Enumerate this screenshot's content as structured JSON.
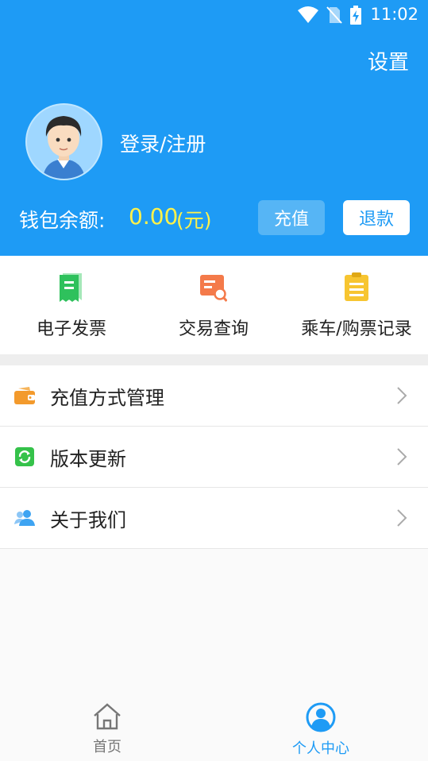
{
  "status_bar": {
    "time": "11:02",
    "icons": [
      "wifi-icon",
      "no-sim-icon",
      "battery-charging-icon"
    ]
  },
  "header": {
    "settings_label": "设置",
    "login_label": "登录/注册",
    "wallet": {
      "label": "钱包余额:",
      "amount": "0.00",
      "unit": "(元)",
      "recharge_label": "充值",
      "refund_label": "退款"
    }
  },
  "quick_actions": [
    {
      "label": "电子发票",
      "icon": "receipt-icon",
      "color": "#2ec15c"
    },
    {
      "label": "交易查询",
      "icon": "transaction-search-icon",
      "color": "#f47a4a"
    },
    {
      "label": "乘车/购票记录",
      "icon": "clipboard-list-icon",
      "color": "#f7c531"
    }
  ],
  "menu": [
    {
      "label": "充值方式管理",
      "icon": "wallet-icon",
      "color": "#f39a2c"
    },
    {
      "label": "版本更新",
      "icon": "refresh-icon",
      "color": "#35c24a"
    },
    {
      "label": "关于我们",
      "icon": "users-icon",
      "color": "#3ea4f2"
    }
  ],
  "tab_bar": [
    {
      "label": "首页",
      "icon": "home-icon",
      "active": false
    },
    {
      "label": "个人中心",
      "icon": "profile-icon",
      "active": true
    }
  ],
  "colors": {
    "primary": "#1e9bf5",
    "balance": "#fff24a",
    "active_tab": "#1e9bf5",
    "inactive_tab": "#777777"
  }
}
